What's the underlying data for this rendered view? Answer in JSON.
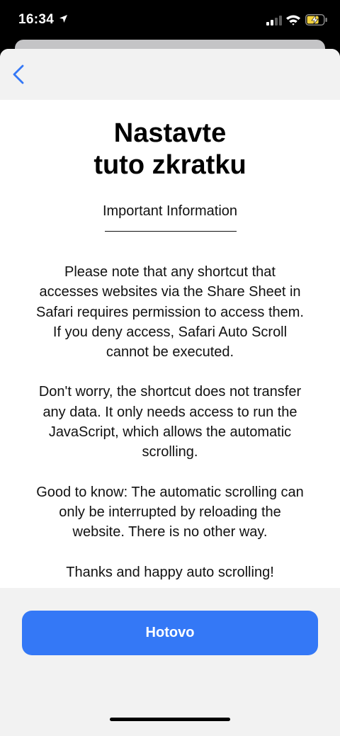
{
  "status_bar": {
    "time": "16:34",
    "icons": [
      "location-arrow-icon",
      "cellular-signal-icon",
      "wifi-icon",
      "battery-charging-icon"
    ],
    "battery_color": "#f5d33f"
  },
  "nav": {
    "back_icon": "chevron-left-icon",
    "accent": "#3478f6"
  },
  "main": {
    "title_line1": "Nastavte",
    "title_line2": "tuto zkratku",
    "subtitle": "Important Information",
    "paragraphs": [
      "Please note that any shortcut that\naccesses websites via the Share Sheet in\nSafari requires permission to access them.\nIf you deny access, Safari Auto Scroll\ncannot be executed.",
      "Don't worry, the shortcut does not transfer\nany data. It only needs access to run the\nJavaScript, which allows the automatic\nscrolling.",
      "Good to know: The automatic scrolling can\nonly be interrupted by reloading the\nwebsite. There is no other way.",
      "Thanks and happy auto scrolling!"
    ]
  },
  "footer": {
    "done_label": "Hotovo",
    "button_color": "#3478f6"
  }
}
